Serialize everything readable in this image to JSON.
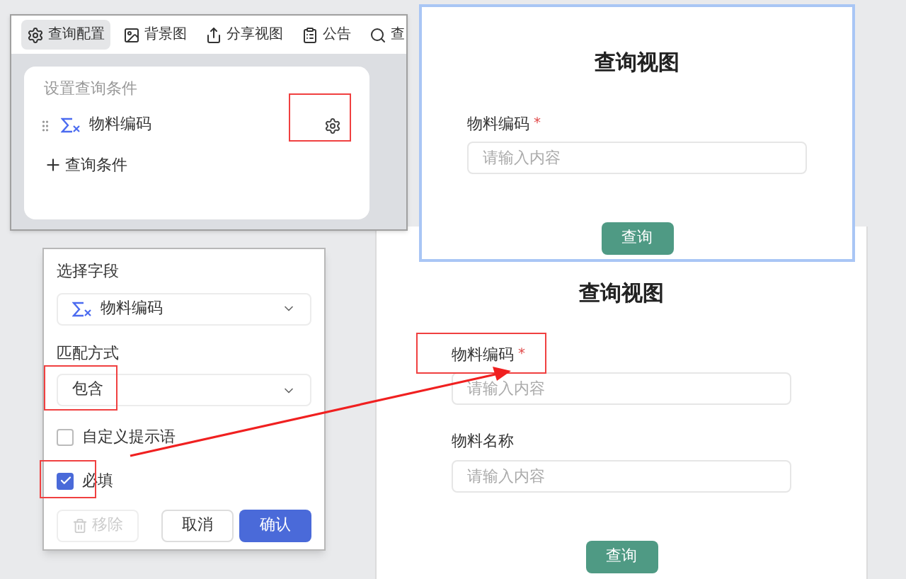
{
  "toolbar": {
    "tabs": [
      {
        "label": "查询配置",
        "selected": true
      },
      {
        "label": "背景图",
        "selected": false
      },
      {
        "label": "分享视图",
        "selected": false
      },
      {
        "label": "公告",
        "selected": false
      },
      {
        "label": "查",
        "selected": false
      }
    ]
  },
  "conditions_card": {
    "heading": "设置查询条件",
    "conditions": [
      {
        "field": "物料编码"
      }
    ],
    "add_button": "查询条件"
  },
  "field_popover": {
    "field_label": "选择字段",
    "field_value": "物料编码",
    "match_label": "匹配方式",
    "match_value": "包含",
    "options": [
      {
        "label": "自定义提示语",
        "checked": false
      },
      {
        "label": "必填",
        "checked": true
      }
    ],
    "remove_button": {
      "label": "移除",
      "disabled": true
    },
    "cancel_button": "取消",
    "confirm_button": "确认"
  },
  "preview_before": {
    "title": "查询视图",
    "fields": [
      {
        "label": "物料编码",
        "required_mark": "*",
        "placeholder": "请输入内容"
      }
    ],
    "submit": "查询"
  },
  "preview_after": {
    "title": "查询视图",
    "fields": [
      {
        "label": "物料编码",
        "required_mark": "*",
        "placeholder": "请输入内容"
      },
      {
        "label": "物料名称",
        "placeholder": "请输入内容"
      }
    ],
    "submit": "查询"
  }
}
